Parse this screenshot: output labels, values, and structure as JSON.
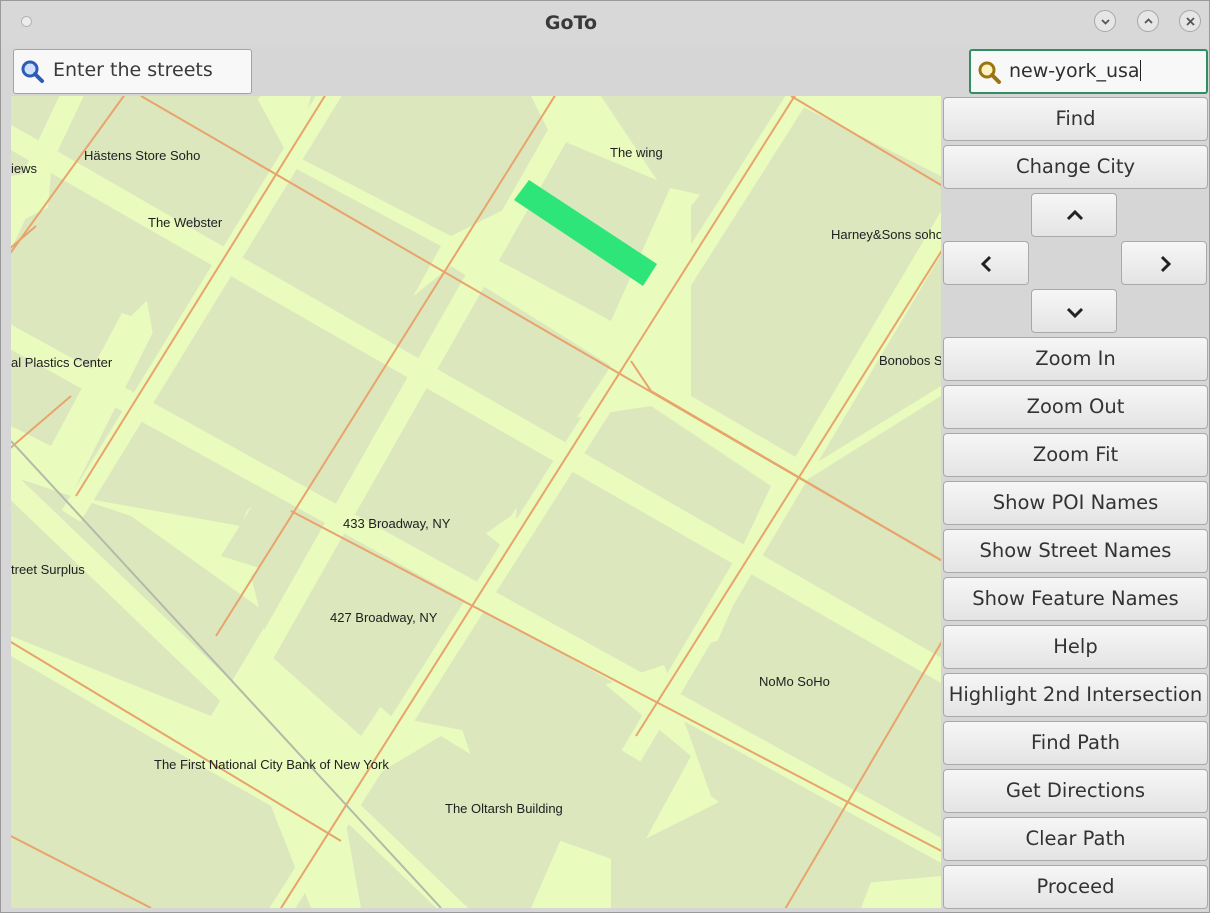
{
  "window": {
    "title": "GoTo"
  },
  "title_buttons": [
    {
      "icon": "chevron-down-icon"
    },
    {
      "icon": "chevron-up-icon"
    },
    {
      "icon": "close-icon"
    }
  ],
  "street_search": {
    "value": "Enter the streets",
    "icon": "search-icon"
  },
  "city_search": {
    "value": "new-york_usa",
    "icon": "search-icon",
    "border_color": "#2f8f63"
  },
  "map": {
    "colors": {
      "background": "#e9fbbd",
      "blocks": "#dce7be",
      "roads": "#e8a46b",
      "highlight": "#2ee57a",
      "rail": "#b4b9a8"
    },
    "labels": [
      "iews",
      "Hästens Store Soho",
      "The Webster",
      "The wing",
      "Harney&Sons soho",
      "al Plastics Center",
      "Bonobos S",
      "433 Broadway, NY",
      "treet Surplus",
      "427 Broadway, NY",
      "NoMo SoHo",
      "The First National City Bank of New York",
      "The Oltarsh Building"
    ]
  },
  "panel": {
    "find": "Find",
    "change_city": "Change City",
    "pan": {
      "up": "chevron-up-icon",
      "left": "chevron-left-icon",
      "right": "chevron-right-icon",
      "down": "chevron-down-icon"
    },
    "buttons": [
      "Zoom In",
      "Zoom Out",
      "Zoom Fit",
      "Show POI Names",
      "Show Street Names",
      "Show Feature Names",
      "Help",
      "Highlight 2nd Intersection",
      "Find Path",
      "Get Directions",
      "Clear Path",
      "Proceed"
    ]
  }
}
